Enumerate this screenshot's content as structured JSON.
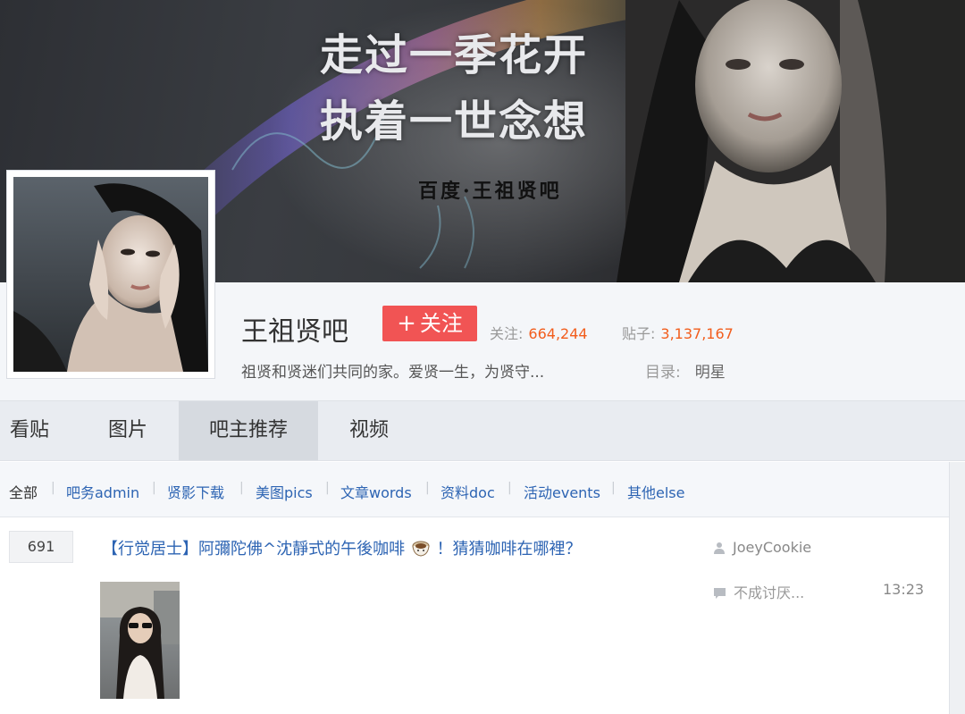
{
  "banner": {
    "line1": "走过一季花开",
    "line2": "执着一世念想",
    "sub": "百度·王祖贤吧"
  },
  "forum": {
    "name": "王祖贤吧",
    "follow_label": "关注",
    "follow_plus": "+",
    "followers_label": "关注:",
    "followers": "664,244",
    "posts_label": "贴子:",
    "posts": "3,137,167",
    "slogan": "祖贤和贤迷们共同的家。爱贤一生，为贤守...",
    "catalog_label": "目录:",
    "catalog_value": "明星"
  },
  "tabs": [
    {
      "label": "看贴"
    },
    {
      "label": "图片"
    },
    {
      "label": "吧主推荐"
    },
    {
      "label": "视频"
    }
  ],
  "filters": [
    {
      "label": "全部"
    },
    {
      "label": "吧务admin"
    },
    {
      "label": "贤影下载"
    },
    {
      "label": "美图pics"
    },
    {
      "label": "文章words"
    },
    {
      "label": "资料doc"
    },
    {
      "label": "活动events"
    },
    {
      "label": "其他else"
    }
  ],
  "thread": {
    "reply_count": "691",
    "title_a": "【行觉居士】阿彌陀佛^沈靜式的午後咖啡",
    "title_b": "！猜猜咖啡在哪裡？",
    "author": "JoeyCookie",
    "last_reply": "不成讨厌...",
    "time": "13:23"
  },
  "colors": {
    "link": "#2d64b3",
    "follow_button": "#f15454",
    "stat_number": "#f25d1c"
  },
  "icons": [
    "user-icon",
    "comment-icon",
    "coffee-icon",
    "plus-icon"
  ]
}
